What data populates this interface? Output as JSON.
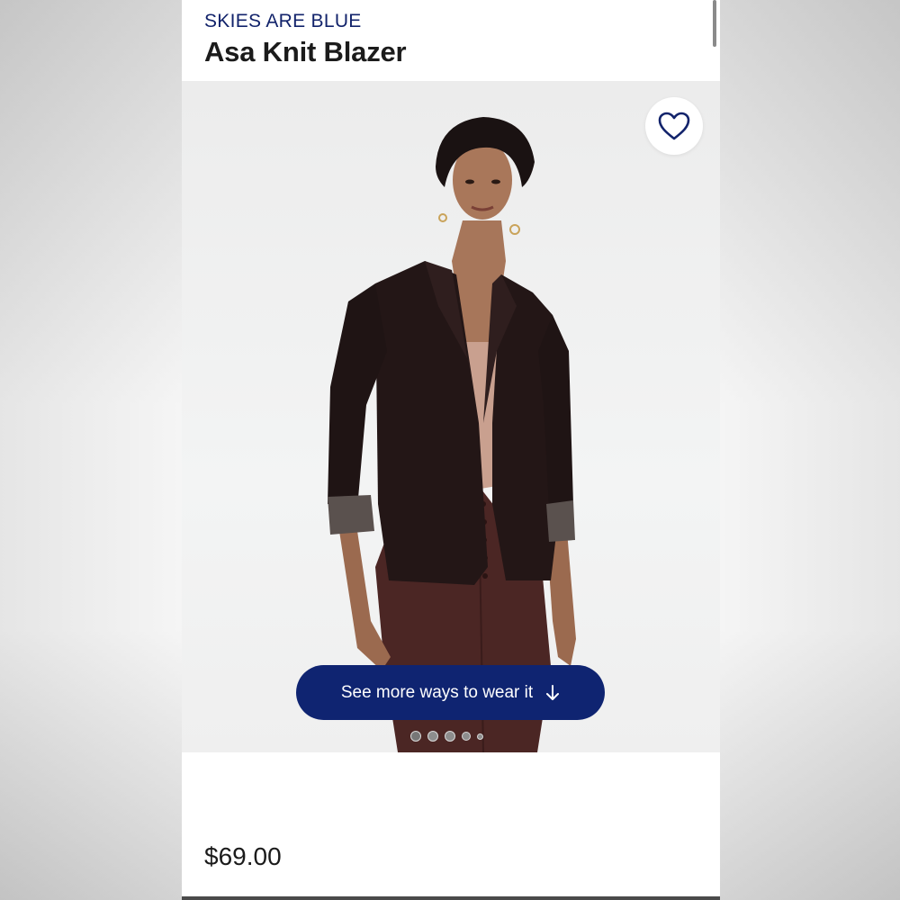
{
  "product": {
    "brand": "SKIES ARE BLUE",
    "title": "Asa Knit Blazer",
    "price": "$69.00"
  },
  "gallery": {
    "cta_label": "See more ways to wear it",
    "cta_icon": "arrow-down-icon",
    "favorite_icon": "heart-icon",
    "dots_count": 5
  },
  "colors": {
    "brand_navy": "#12236b",
    "button_navy": "#0f2471",
    "text_dark": "#1b1b1b"
  }
}
